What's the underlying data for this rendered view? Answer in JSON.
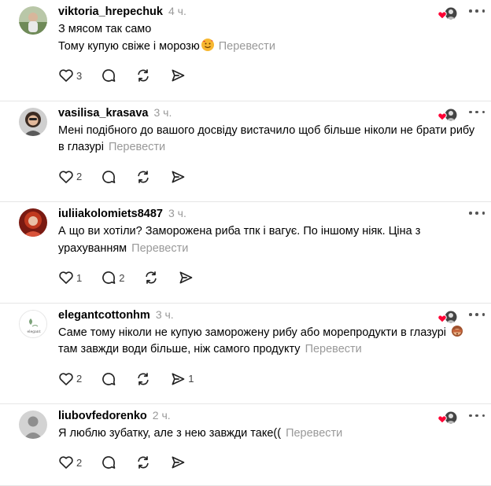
{
  "comments": [
    {
      "username": "viktoria_hrepechuk",
      "time": "4 ч.",
      "lines": [
        "З мясом так само",
        "Тому купую свіже і морозю"
      ],
      "emoji": "smiling-face-with-hearts",
      "translate": "Перевести",
      "likes": "3",
      "replies": "",
      "reposts": "",
      "shares": ""
    },
    {
      "username": "vasilisa_krasava",
      "time": "3 ч.",
      "lines": [
        "Мені подібного до вашого досвіду вистачило щоб більше ніколи не брати рибу в глазурі"
      ],
      "translate": "Перевести",
      "likes": "2",
      "replies": "",
      "reposts": "",
      "shares": ""
    },
    {
      "username": "iuliiakolomiets8487",
      "time": "3 ч.",
      "lines": [
        "А що ви хотіли? Заморожена риба тпк і вагує. По іншому ніяк. Ціна з урахуванням"
      ],
      "translate": "Перевести",
      "likes": "1",
      "replies": "2",
      "reposts": "",
      "shares": ""
    },
    {
      "username": "elegantcottonhm",
      "time": "3 ч.",
      "lines": [
        "Саме тому ніколи не купую заморожену рибу або морепродукти в глазурі",
        "там завжди води більше, ніж самого продукту"
      ],
      "emoji": "see-no-evil-monkey",
      "translate": "Перевести",
      "likes": "2",
      "replies": "",
      "reposts": "",
      "shares": "1",
      "avatar_text": "elegant"
    },
    {
      "username": "liubovfedorenko",
      "time": "2 ч.",
      "lines": [
        "Я люблю зубатку, але з нею завжди таке(("
      ],
      "translate": "Перевести",
      "likes": "2",
      "replies": "",
      "reposts": "",
      "shares": ""
    }
  ],
  "colors": {
    "heart": "#ff0034",
    "muted": "#999999",
    "divider": "#e6e6e6"
  },
  "icons": [
    "heart-icon",
    "reply-icon",
    "repost-icon",
    "share-icon",
    "more-icon"
  ]
}
